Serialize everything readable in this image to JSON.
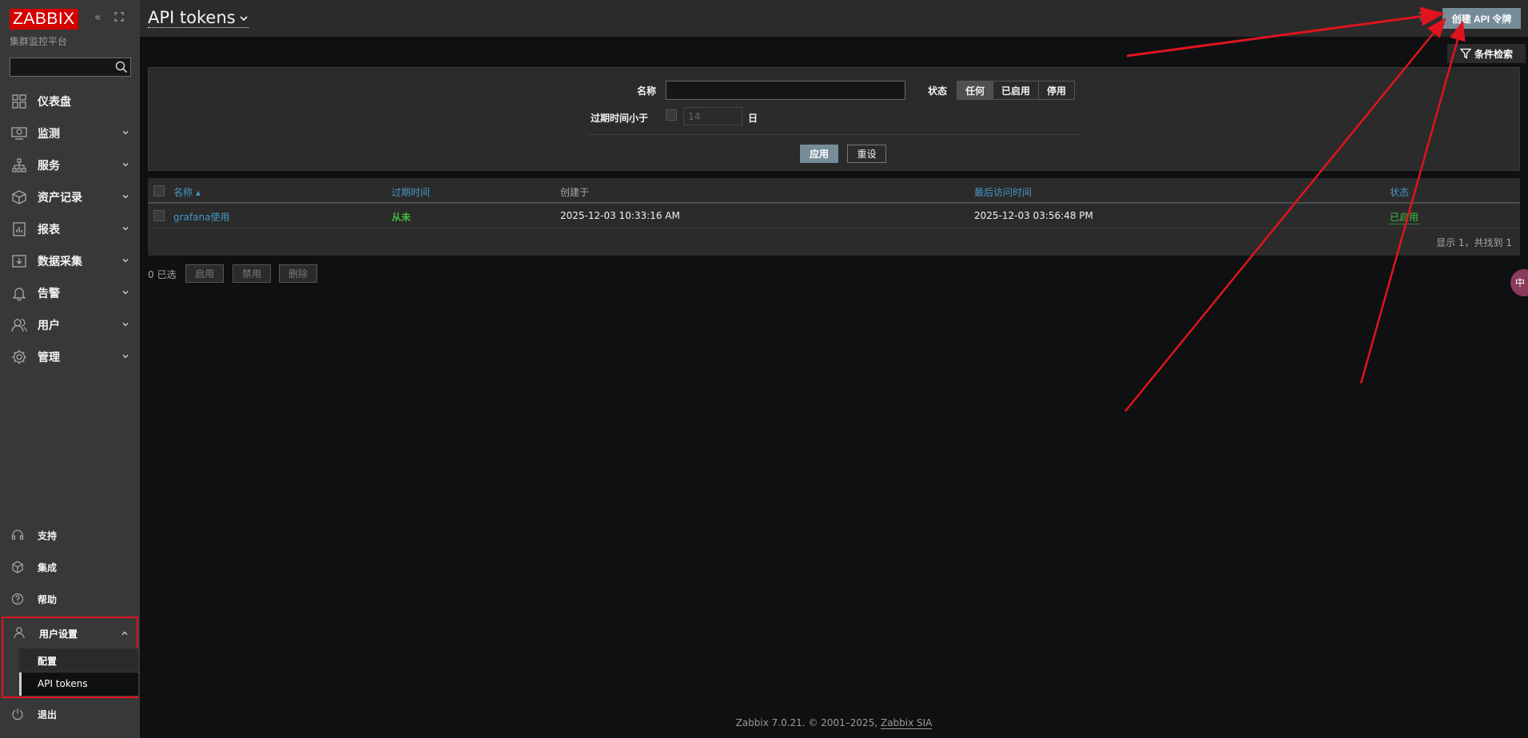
{
  "sidebar": {
    "logo": "ZABBIX",
    "subtitle": "集群监控平台",
    "search": {
      "value": "",
      "placeholder": ""
    },
    "items": [
      {
        "label": "仪表盘",
        "icon": "dashboard-icon"
      },
      {
        "label": "监测",
        "icon": "monitoring-icon"
      },
      {
        "label": "服务",
        "icon": "services-icon"
      },
      {
        "label": "资产记录",
        "icon": "inventory-icon"
      },
      {
        "label": "报表",
        "icon": "reports-icon"
      },
      {
        "label": "数据采集",
        "icon": "data-collection-icon"
      },
      {
        "label": "告警",
        "icon": "alerts-icon"
      },
      {
        "label": "用户",
        "icon": "users-icon"
      },
      {
        "label": "管理",
        "icon": "administration-icon"
      }
    ],
    "bottom": {
      "support": "支持",
      "integrations": "集成",
      "help": "帮助",
      "user_settings": "用户设置",
      "profile": "配置",
      "api_tokens": "API tokens",
      "logout": "退出"
    }
  },
  "header": {
    "title": "API tokens",
    "help": "?",
    "create_button": "创建 API 令牌"
  },
  "filter": {
    "tab_label": "条件检索",
    "name_label": "名称",
    "name_value": "",
    "status_label": "状态",
    "status_options": [
      "任何",
      "已启用",
      "停用"
    ],
    "status_selected": "任何",
    "expires_label": "过期时间小于",
    "expires_days": "14",
    "days_unit": "日",
    "apply": "应用",
    "reset": "重设"
  },
  "table": {
    "columns": {
      "name": "名称 ▴",
      "expires": "过期时间",
      "created": "创建于",
      "last_access": "最后访问时间",
      "status": "状态"
    },
    "rows": [
      {
        "name": "grafana使用",
        "expires": "从未",
        "created": "2025-12-03 10:33:16 AM",
        "last_access": "2025-12-03 03:56:48 PM",
        "status": "已启用"
      }
    ],
    "footer": "显示 1，共找到 1"
  },
  "actions": {
    "selected": "0 已选",
    "enable": "启用",
    "disable": "禁用",
    "delete": "删除"
  },
  "footer": {
    "text": "Zabbix 7.0.21. © 2001–2025,",
    "link": "Zabbix SIA"
  },
  "float_badge": "中",
  "colors": {
    "sidebar_bg": "#383838",
    "page_bg": "#0e1012",
    "panel_bg": "#2b2b2b",
    "link": "#4796c4",
    "accent_button": "#768d99",
    "logo_red": "#d40000",
    "status_green": "#3fbf3f",
    "annotation_red": "#e0141e"
  }
}
